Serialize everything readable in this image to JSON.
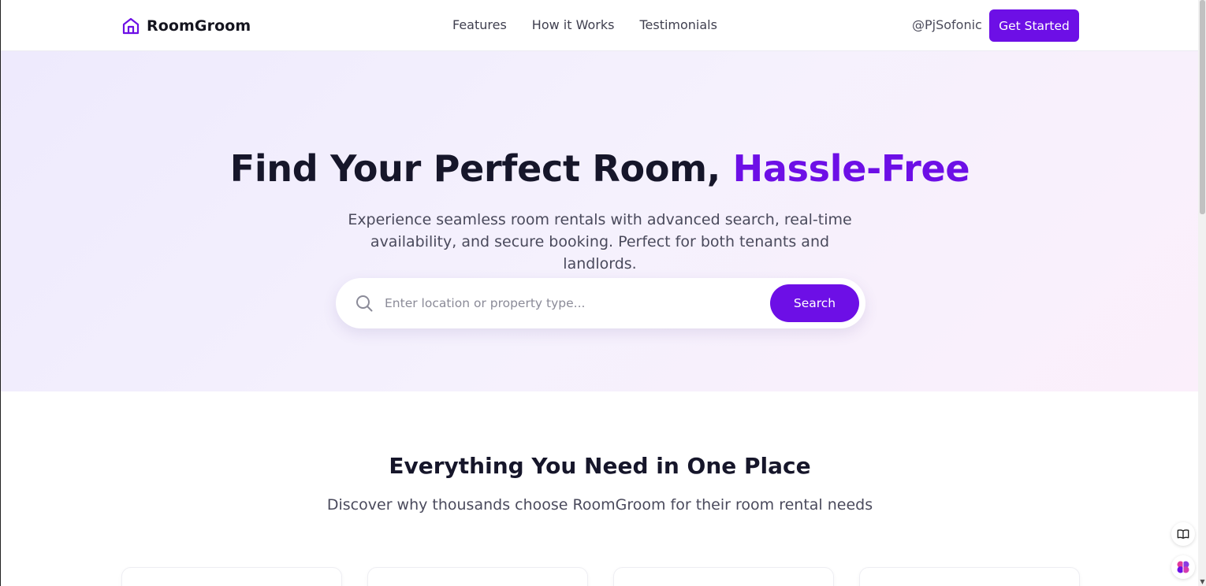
{
  "header": {
    "brand": "RoomGroom",
    "nav": [
      "Features",
      "How it Works",
      "Testimonials"
    ],
    "user_handle": "@PjSofonic",
    "cta_label": "Get Started"
  },
  "hero": {
    "title_main": "Find Your Perfect Room, ",
    "title_accent": "Hassle-Free",
    "subtitle": "Experience seamless room rentals with advanced search, real-time availability, and secure booking. Perfect for both tenants and landlords.",
    "search_placeholder": "Enter location or property type...",
    "search_button": "Search"
  },
  "features": {
    "title": "Everything You Need in One Place",
    "subtitle": "Discover why thousands choose RoomGroom for their room rental needs"
  },
  "icons": {
    "logo": "home-icon",
    "search": "search-icon",
    "book": "book-icon",
    "assistant": "brain-icon"
  },
  "colors": {
    "accent": "#6d0fe6",
    "text_dark": "#16162a",
    "text_muted": "#4a4a5c"
  }
}
